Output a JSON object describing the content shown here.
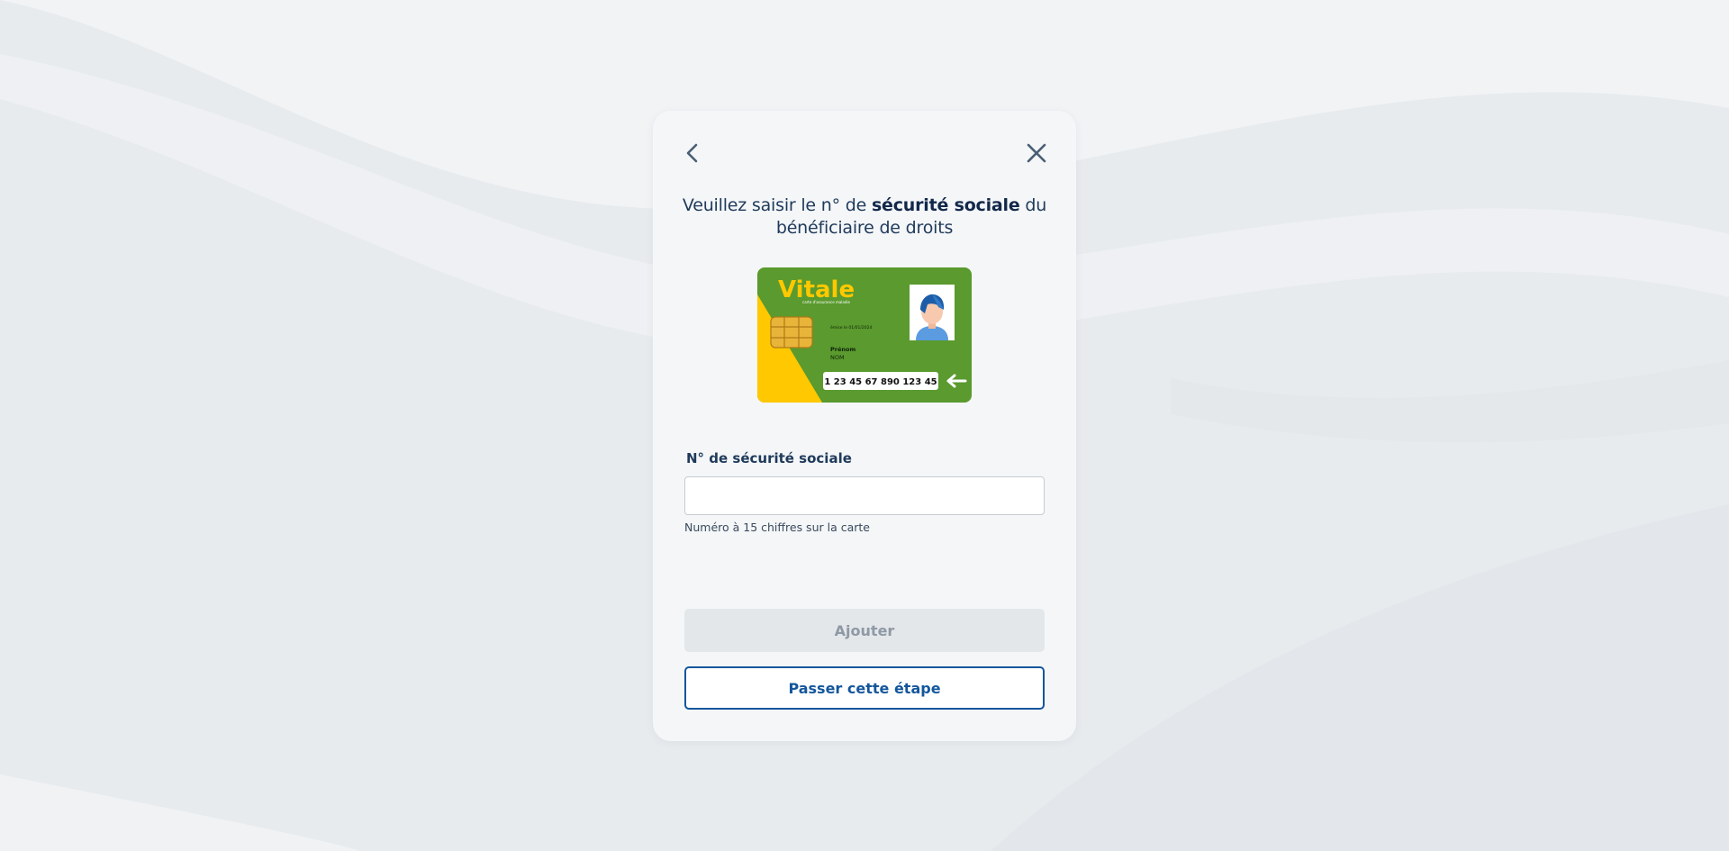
{
  "modal": {
    "back_icon": "chevron-left-icon",
    "close_icon": "close-icon",
    "title_prefix": "Veuillez saisir le n° de ",
    "title_bold": "sécurité sociale",
    "title_suffix": " du bénéficiaire de droits"
  },
  "card": {
    "brand": "Vitale",
    "subtitle": "carte d'assurance maladie",
    "issued": "émise le 01/01/2024",
    "first_name": "Prénom",
    "last_name": "NOM",
    "number": "1 23 45 67 890 123 45",
    "colors": {
      "green": "#5a9a2e",
      "yellow": "#ffc800"
    }
  },
  "form": {
    "label": "N° de sécurité sociale",
    "value": "",
    "placeholder": "",
    "hint": "Numéro à 15 chiffres sur la carte"
  },
  "actions": {
    "add_label": "Ajouter",
    "skip_label": "Passer cette étape"
  },
  "colors": {
    "primary": "#14569c",
    "text": "#1f3a5a",
    "disabled_bg": "#e4e7ea",
    "disabled_text": "#8e99a5"
  }
}
